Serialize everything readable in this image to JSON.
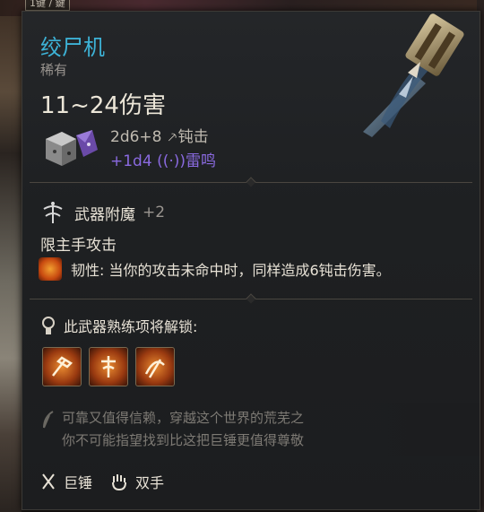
{
  "background": {
    "hotkey_label": "1键 / 鍵"
  },
  "item": {
    "name": "绞尸机",
    "rarity": "稀有",
    "damage_range": "11~24伤害",
    "damage_lines": [
      {
        "dice": "2d6+8",
        "type": "钝击",
        "icon": "blunt-icon"
      },
      {
        "dice": "+1d4",
        "type": "雷鸣",
        "icon": "thunder-icon"
      }
    ],
    "colors": {
      "name": "#3db2d6",
      "thunder": "#8a6ae0"
    }
  },
  "enchant": {
    "label": "武器附魔",
    "value": "+2"
  },
  "property": {
    "restriction": "限主手攻击",
    "toughness": "韧性: 当你的攻击未命中时，同样造成6钝击伤害。"
  },
  "proficiency": {
    "label": "此武器熟练项将解锁:",
    "actions": [
      "action-icon-1",
      "action-icon-2",
      "action-icon-3"
    ]
  },
  "flavor": {
    "line1": "可靠又值得信赖，穿越这个世界的荒芜之",
    "line2": "你不可能指望找到比这把巨锤更值得尊敬"
  },
  "tags": [
    {
      "icon": "maul-icon",
      "label": "巨锤"
    },
    {
      "icon": "two-hand-icon",
      "label": "双手"
    }
  ]
}
